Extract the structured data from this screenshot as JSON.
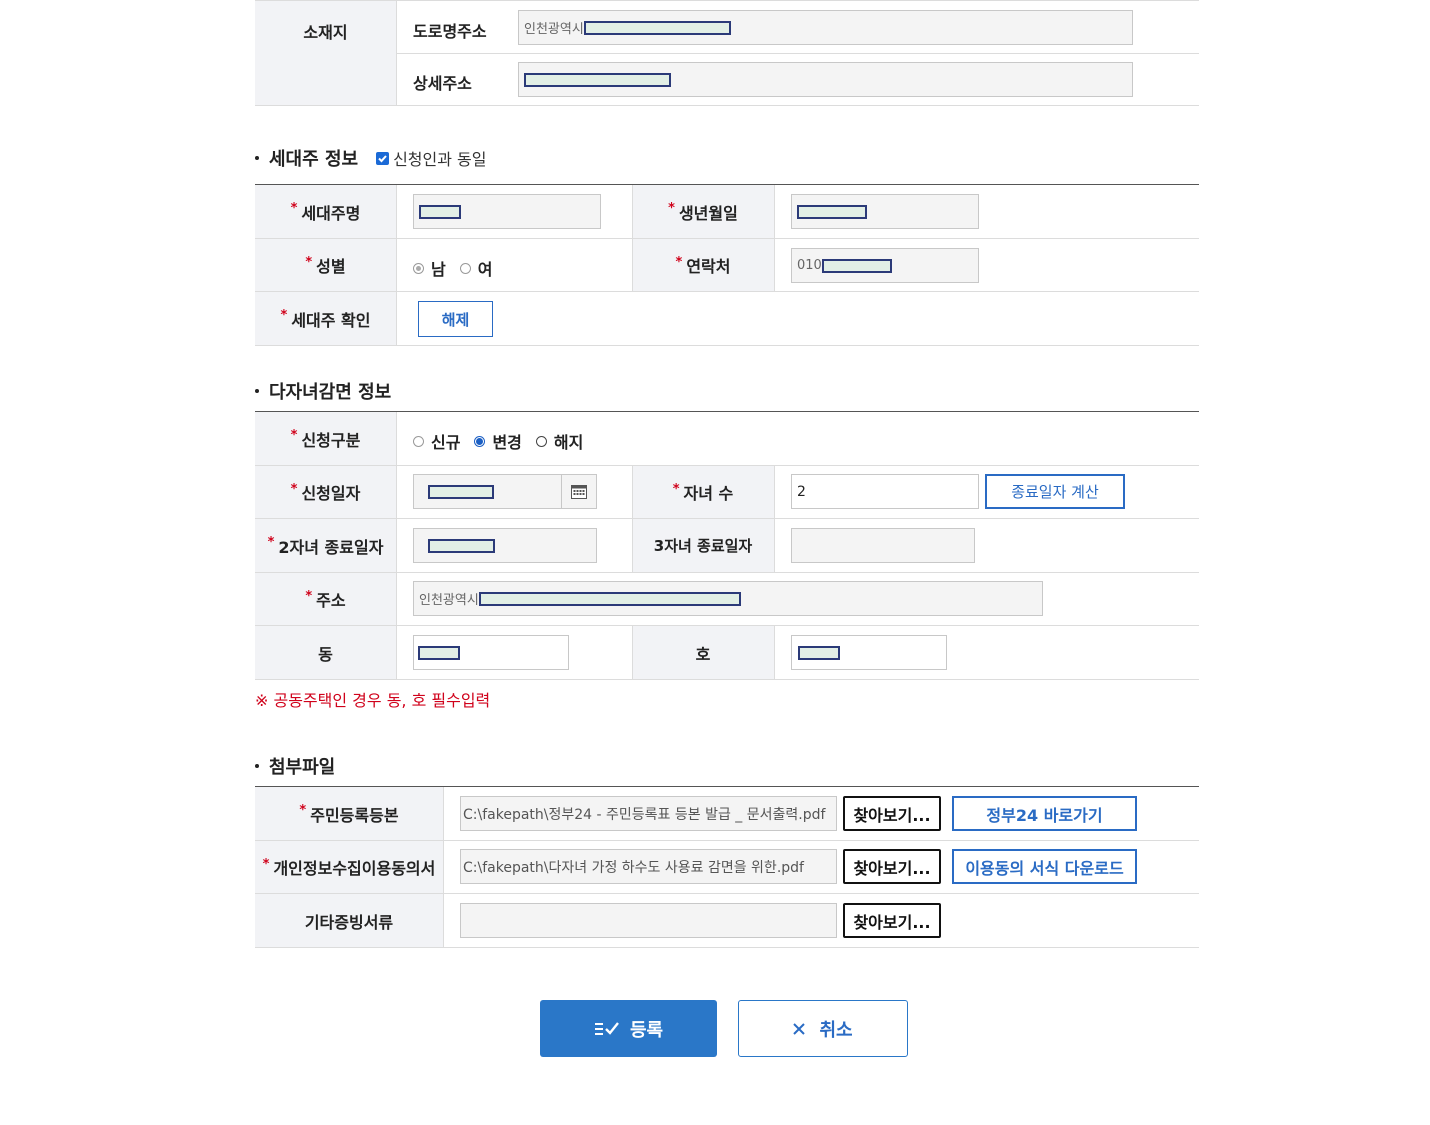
{
  "location": {
    "label": "소재지",
    "road_address_label": "도로명주소",
    "road_address_value": "인천광역시",
    "detail_address_label": "상세주소"
  },
  "householder": {
    "section_title": "세대주 정보",
    "same_as_applicant_label": "신청인과 동일",
    "name_label": "세대주명",
    "birth_label": "생년월일",
    "gender_label": "성별",
    "gender_options": [
      "남",
      "여"
    ],
    "contact_label": "연락처",
    "contact_prefix": "010",
    "confirm_label": "세대주 확인",
    "release_button": "해제"
  },
  "discount": {
    "section_title": "다자녀감면 정보",
    "apply_type_label": "신청구분",
    "apply_type_options": [
      "신규",
      "변경",
      "해지"
    ],
    "apply_date_label": "신청일자",
    "children_label": "자녀 수",
    "children_value": "2",
    "calc_end_date_button": "종료일자 계산",
    "second_child_end_label": "2자녀 종료일자",
    "third_child_end_label": "3자녀 종료일자",
    "address_label": "주소",
    "address_value": "인천광역시",
    "dong_label": "동",
    "ho_label": "호",
    "notice": "※ 공동주택인 경우 동, 호 필수입력"
  },
  "attachments": {
    "section_title": "첨부파일",
    "resident_reg_label": "주민등록등본",
    "resident_reg_file": "C:\\fakepath\\정부24 - 주민등록표 등본 발급 _ 문서출력.pdf",
    "privacy_consent_label": "개인정보수집이용동의서",
    "privacy_consent_file": "C:\\fakepath\\다자녀 가정 하수도 사용료 감면을 위한.pdf",
    "other_docs_label": "기타증빙서류",
    "browse_label": "찾아보기...",
    "gov24_button": "정부24 바로가기",
    "consent_form_button": "이용동의 서식 다운로드"
  },
  "actions": {
    "register": "등록",
    "cancel": "취소"
  },
  "colors": {
    "accent": "#2a77c8",
    "required": "#d0021b",
    "header_bg": "#f2f3f6"
  }
}
